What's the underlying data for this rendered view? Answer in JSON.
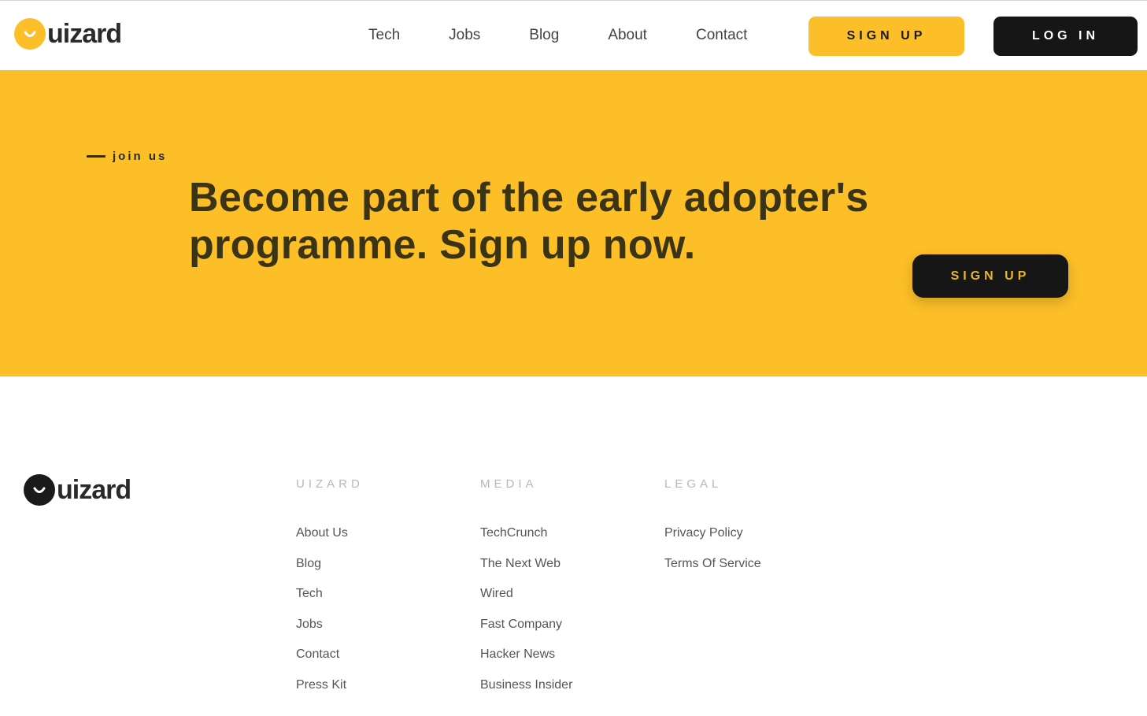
{
  "header": {
    "logo_text": "uizard",
    "nav": [
      "Tech",
      "Jobs",
      "Blog",
      "About",
      "Contact"
    ],
    "signup_label": "SIGN UP",
    "login_label": "LOG IN"
  },
  "hero": {
    "eyebrow": "join us",
    "heading": "Become part of the early adopter's programme. Sign up now.",
    "cta_label": "SIGN UP"
  },
  "footer": {
    "logo_text": "uizard",
    "columns": [
      {
        "heading": "UIZARD",
        "links": [
          "About Us",
          "Blog",
          "Tech",
          "Jobs",
          "Contact",
          "Press Kit"
        ]
      },
      {
        "heading": "MEDIA",
        "links": [
          "TechCrunch",
          "The Next Web",
          "Wired",
          "Fast Company",
          "Hacker News",
          "Business Insider"
        ]
      },
      {
        "heading": "LEGAL",
        "links": [
          "Privacy Policy",
          "Terms Of Service"
        ]
      }
    ]
  },
  "colors": {
    "brand_yellow": "#fcbf28",
    "dark": "#161616"
  }
}
